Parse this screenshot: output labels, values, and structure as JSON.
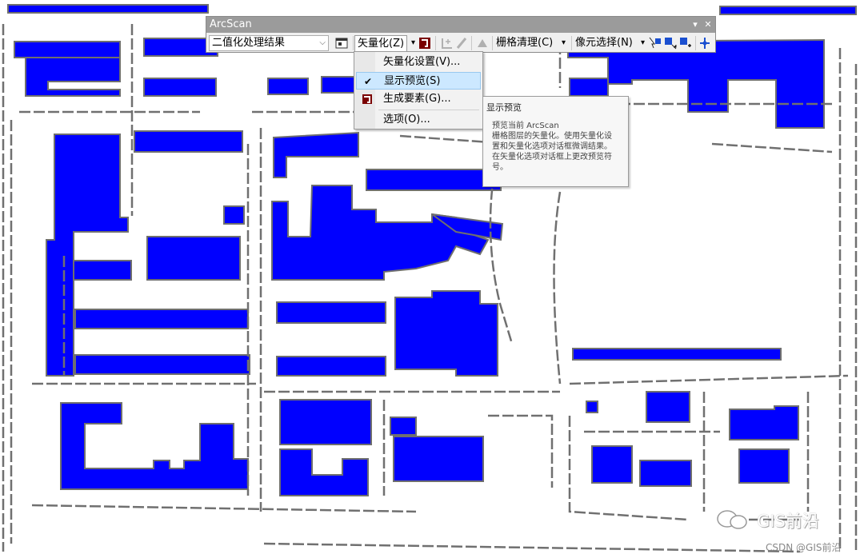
{
  "window": {
    "title": "ArcScan",
    "pin_glyph": "▾",
    "close_glyph": "✕"
  },
  "toolbar": {
    "layer_combo_value": "二值化处理结果",
    "vectorization_menu": "矢量化(Z)",
    "raster_cleanup_menu": "栅格清理(C)",
    "cell_selection_menu": "像元选择(N)"
  },
  "vectorization_dropdown": {
    "items": [
      {
        "label": "矢量化设置(V)...",
        "checked": false,
        "icon": ""
      },
      {
        "label": "显示预览(S)",
        "checked": true,
        "icon": "check-icon"
      },
      {
        "label": "生成要素(G)...",
        "checked": false,
        "icon": "generate-features-icon"
      },
      {
        "label": "选项(O)...",
        "checked": false,
        "icon": ""
      }
    ]
  },
  "tooltip": {
    "title": "显示预览",
    "lines": [
      "预览当前 ArcScan",
      "栅格图层的矢量化。使用矢量化设",
      "置和矢量化选项对话框微调结果。",
      "在矢量化选项对话框上更改预览符",
      "号。"
    ]
  },
  "watermark": {
    "text": "GIS前沿",
    "source": "CSDN @GIS前沿"
  },
  "colors": {
    "polygon_fill": "#0000ff",
    "outline": "#707070",
    "title_bar": "#9b9b9b",
    "highlight": "#cce8ff"
  }
}
